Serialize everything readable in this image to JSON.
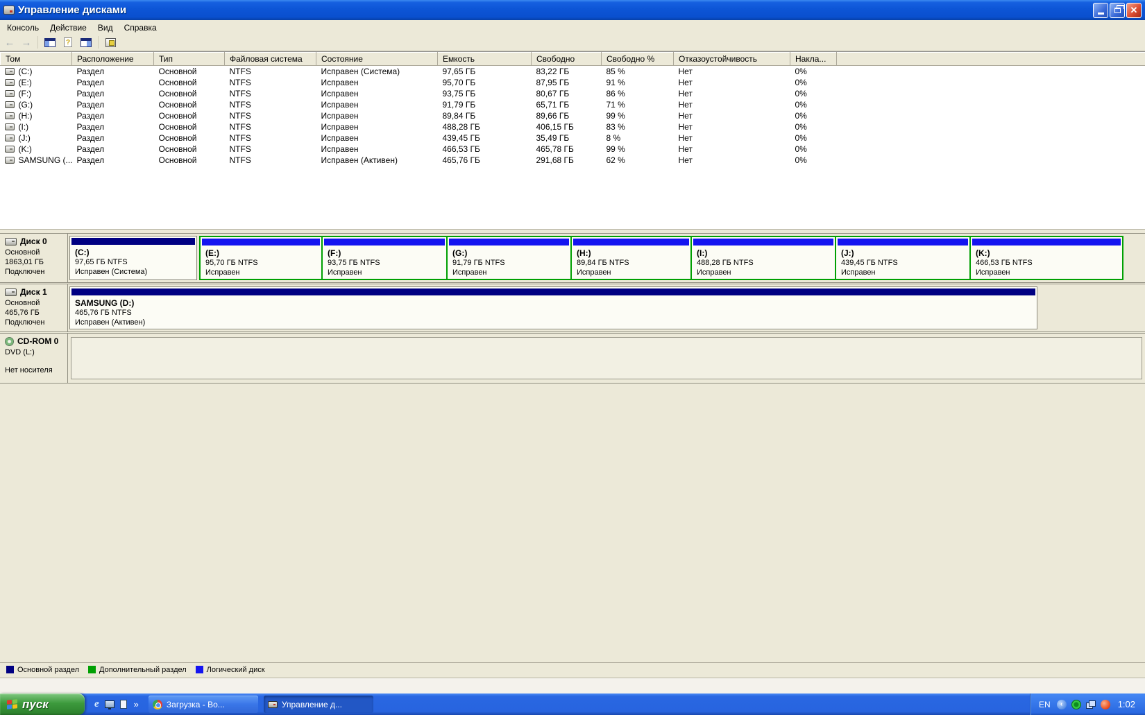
{
  "window": {
    "title": "Управление дисками"
  },
  "menu": {
    "items": [
      "Консоль",
      "Действие",
      "Вид",
      "Справка"
    ]
  },
  "volume_table": {
    "columns": [
      "Том",
      "Расположение",
      "Тип",
      "Файловая система",
      "Состояние",
      "Емкость",
      "Свободно",
      "Свободно %",
      "Отказоустойчивость",
      "Накла..."
    ],
    "rows": [
      {
        "vol": "(C:)",
        "loc": "Раздел",
        "type": "Основной",
        "fs": "NTFS",
        "status": "Исправен (Система)",
        "cap": "97,65 ГБ",
        "free": "83,22 ГБ",
        "pct": "85 %",
        "ft": "Нет",
        "ovh": "0%"
      },
      {
        "vol": "(E:)",
        "loc": "Раздел",
        "type": "Основной",
        "fs": "NTFS",
        "status": "Исправен",
        "cap": "95,70 ГБ",
        "free": "87,95 ГБ",
        "pct": "91 %",
        "ft": "Нет",
        "ovh": "0%"
      },
      {
        "vol": "(F:)",
        "loc": "Раздел",
        "type": "Основной",
        "fs": "NTFS",
        "status": "Исправен",
        "cap": "93,75 ГБ",
        "free": "80,67 ГБ",
        "pct": "86 %",
        "ft": "Нет",
        "ovh": "0%"
      },
      {
        "vol": "(G:)",
        "loc": "Раздел",
        "type": "Основной",
        "fs": "NTFS",
        "status": "Исправен",
        "cap": "91,79 ГБ",
        "free": "65,71 ГБ",
        "pct": "71 %",
        "ft": "Нет",
        "ovh": "0%"
      },
      {
        "vol": "(H:)",
        "loc": "Раздел",
        "type": "Основной",
        "fs": "NTFS",
        "status": "Исправен",
        "cap": "89,84 ГБ",
        "free": "89,66 ГБ",
        "pct": "99 %",
        "ft": "Нет",
        "ovh": "0%"
      },
      {
        "vol": "(I:)",
        "loc": "Раздел",
        "type": "Основной",
        "fs": "NTFS",
        "status": "Исправен",
        "cap": "488,28 ГБ",
        "free": "406,15 ГБ",
        "pct": "83 %",
        "ft": "Нет",
        "ovh": "0%"
      },
      {
        "vol": "(J:)",
        "loc": "Раздел",
        "type": "Основной",
        "fs": "NTFS",
        "status": "Исправен",
        "cap": "439,45 ГБ",
        "free": "35,49 ГБ",
        "pct": "8 %",
        "ft": "Нет",
        "ovh": "0%"
      },
      {
        "vol": "(K:)",
        "loc": "Раздел",
        "type": "Основной",
        "fs": "NTFS",
        "status": "Исправен",
        "cap": "466,53 ГБ",
        "free": "465,78 ГБ",
        "pct": "99 %",
        "ft": "Нет",
        "ovh": "0%"
      },
      {
        "vol": "SAMSUNG (...",
        "loc": "Раздел",
        "type": "Основной",
        "fs": "NTFS",
        "status": "Исправен (Активен)",
        "cap": "465,76 ГБ",
        "free": "291,68 ГБ",
        "pct": "62 %",
        "ft": "Нет",
        "ovh": "0%"
      }
    ]
  },
  "disks": [
    {
      "name": "Диск 0",
      "kind": "Основной",
      "size": "1863,01 ГБ",
      "status": "Подключен",
      "partitions": [
        {
          "label": "(C:)",
          "line2": "97,65 ГБ NTFS",
          "line3": "Исправен (Система)"
        },
        {
          "label": "(E:)",
          "line2": "95,70 ГБ NTFS",
          "line3": "Исправен"
        },
        {
          "label": "(F:)",
          "line2": "93,75 ГБ NTFS",
          "line3": "Исправен"
        },
        {
          "label": "(G:)",
          "line2": "91,79 ГБ NTFS",
          "line3": "Исправен"
        },
        {
          "label": "(H:)",
          "line2": "89,84 ГБ NTFS",
          "line3": "Исправен"
        },
        {
          "label": "(I:)",
          "line2": "488,28 ГБ NTFS",
          "line3": "Исправен"
        },
        {
          "label": "(J:)",
          "line2": "439,45 ГБ NTFS",
          "line3": "Исправен"
        },
        {
          "label": "(K:)",
          "line2": "466,53 ГБ NTFS",
          "line3": "Исправен"
        }
      ]
    },
    {
      "name": "Диск 1",
      "kind": "Основной",
      "size": "465,76 ГБ",
      "status": "Подключен",
      "partitions": [
        {
          "label": "SAMSUNG  (D:)",
          "line2": "465,76 ГБ NTFS",
          "line3": "Исправен (Активен)"
        }
      ]
    },
    {
      "name": "CD-ROM 0",
      "kind": "DVD (L:)",
      "status": "Нет носителя",
      "partitions": []
    }
  ],
  "legend": [
    {
      "label": "Основной раздел",
      "color": "#000082"
    },
    {
      "label": "Дополнительный раздел",
      "color": "#00A002"
    },
    {
      "label": "Логический диск",
      "color": "#1414F0"
    }
  ],
  "colors": {
    "primary_bar": "#000082",
    "logical_bar": "#1414F0",
    "extended_border": "#00A002"
  },
  "taskbar": {
    "start_label": "пуск",
    "overflow_chevron": "»",
    "tasks": [
      {
        "label": "Загрузка - Во..."
      },
      {
        "label": "Управление д..."
      }
    ],
    "tray": {
      "lang": "EN",
      "clock": "1:02"
    }
  }
}
